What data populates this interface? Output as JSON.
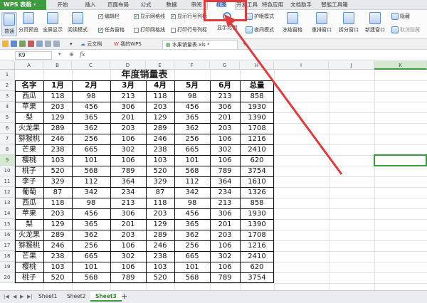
{
  "menubar": {
    "app_name": "WPS 表格",
    "tabs": [
      "开始",
      "插入",
      "页面布局",
      "公式",
      "数据",
      "审阅",
      "视图",
      "开发工具",
      "特色应用",
      "文档助手",
      "智能工具箱"
    ],
    "active_tab": "视图"
  },
  "ribbon": {
    "normal": "普通",
    "page_break": "分页预览",
    "full_screen": "全屏显示",
    "reading_mode": "阅读模式",
    "edit_bar": "编辑栏",
    "task_pane": "任务窗格",
    "show_gridlines": "显示网格线",
    "print_gridlines": "打印网格线",
    "show_row_col_headers": "显示行号列标",
    "print_row_col_headers": "打印行号列标",
    "show_ratio": "显示比例",
    "eye_mode": "护眼模式",
    "night_mode": "夜间模式",
    "freeze_panes": "冻结窗格",
    "rearrange_windows": "重排窗口",
    "split_window": "拆分窗口",
    "new_window": "新建窗口",
    "hide": "隐藏",
    "unhide": "取消隐藏"
  },
  "doc_tabs": {
    "cloud": "云文档",
    "my_wps": "我的WPS",
    "active_file": "水果销量表.xls *"
  },
  "formula_bar": {
    "name_box": "K9",
    "fx": "fx",
    "value": ""
  },
  "grid": {
    "columns": [
      "A",
      "B",
      "C",
      "D",
      "E",
      "F",
      "G",
      "H",
      "I",
      "J",
      "K"
    ],
    "rows": [
      "1",
      "2",
      "3",
      "4",
      "5",
      "6",
      "7",
      "8",
      "9",
      "10",
      "11",
      "12",
      "13",
      "14",
      "15",
      "16",
      "17",
      "18",
      "19",
      "20"
    ],
    "selected_column": "K",
    "selected_row": "9"
  },
  "table": {
    "title": "年度销量表",
    "headers": [
      "名字",
      "1月",
      "2月",
      "3月",
      "4月",
      "5月",
      "6月",
      "总量"
    ],
    "rows": [
      [
        "西瓜",
        "118",
        "98",
        "213",
        "118",
        "98",
        "213",
        "858"
      ],
      [
        "苹果",
        "203",
        "456",
        "306",
        "203",
        "456",
        "306",
        "1930"
      ],
      [
        "梨",
        "129",
        "365",
        "201",
        "129",
        "365",
        "201",
        "1390"
      ],
      [
        "火龙果",
        "289",
        "362",
        "203",
        "289",
        "362",
        "203",
        "1708"
      ],
      [
        "猕猴桃",
        "246",
        "256",
        "106",
        "246",
        "256",
        "106",
        "1216"
      ],
      [
        "芒果",
        "238",
        "665",
        "302",
        "238",
        "665",
        "302",
        "2410"
      ],
      [
        "樱桃",
        "103",
        "101",
        "106",
        "103",
        "101",
        "106",
        "620"
      ],
      [
        "桃子",
        "520",
        "568",
        "789",
        "520",
        "568",
        "789",
        "3754"
      ],
      [
        "李子",
        "329",
        "112",
        "364",
        "329",
        "112",
        "364",
        "1610"
      ],
      [
        "葡萄",
        "87",
        "342",
        "234",
        "87",
        "342",
        "234",
        "1326"
      ],
      [
        "西瓜",
        "118",
        "98",
        "213",
        "118",
        "98",
        "213",
        "858"
      ],
      [
        "苹果",
        "203",
        "456",
        "306",
        "203",
        "456",
        "306",
        "1930"
      ],
      [
        "梨",
        "129",
        "365",
        "201",
        "129",
        "365",
        "201",
        "1390"
      ],
      [
        "火龙果",
        "289",
        "362",
        "203",
        "289",
        "362",
        "203",
        "1708"
      ],
      [
        "猕猴桃",
        "246",
        "256",
        "106",
        "246",
        "256",
        "106",
        "1216"
      ],
      [
        "芒果",
        "238",
        "665",
        "302",
        "238",
        "665",
        "302",
        "2410"
      ],
      [
        "樱桃",
        "103",
        "101",
        "106",
        "103",
        "101",
        "106",
        "620"
      ],
      [
        "桃子",
        "520",
        "568",
        "789",
        "520",
        "568",
        "789",
        "3754"
      ]
    ]
  },
  "sheets": [
    "Sheet1",
    "Sheet2",
    "Sheet3"
  ],
  "active_sheet": "Sheet3",
  "colors": {
    "accent": "#3c9b3c",
    "annotation": "#e23a3a",
    "view_tab": "#2d62b8"
  }
}
